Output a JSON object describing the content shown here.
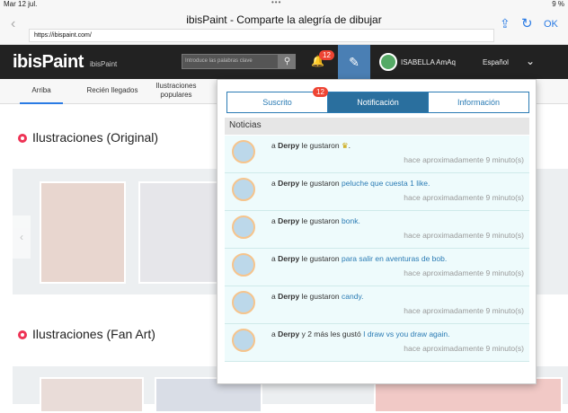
{
  "status": {
    "time": "Mar 12 jul.",
    "battery": "9 %"
  },
  "browser": {
    "title": "ibisPaint - Comparte la alegría de dibujar",
    "url": "https://ibispaint.com/",
    "done_label": "OK"
  },
  "header": {
    "logo": "ibisPaint",
    "logo_sub": "ibisPaint",
    "search_placeholder": "Introduce las palabras clave",
    "bell_count": "12",
    "username": "ISABELLA AmAq",
    "language": "Español"
  },
  "nav": {
    "tabs": [
      {
        "label": "Arriba"
      },
      {
        "label": "Recién llegados"
      },
      {
        "label": "Ilustraciones populares"
      }
    ]
  },
  "sections": [
    {
      "title": "Ilustraciones (Original)"
    },
    {
      "title": "Ilustraciones (Fan Art)"
    }
  ],
  "notifications_panel": {
    "tabs": [
      "Suscrito",
      "Notificación",
      "Información"
    ],
    "tab_badge": "12",
    "news_header": "Noticias",
    "items": [
      {
        "prefix": "a",
        "user": "Derpy",
        "verb": "le gustaron",
        "object": "",
        "time": "hace aproximadamente 9 minuto(s)"
      },
      {
        "prefix": "a",
        "user": "Derpy",
        "verb": "le gustaron",
        "object": "peluche que cuesta 1 like.",
        "time": "hace aproximadamente 9 minuto(s)"
      },
      {
        "prefix": "a",
        "user": "Derpy",
        "verb": "le gustaron",
        "object": "bonk.",
        "time": "hace aproximadamente 9 minuto(s)"
      },
      {
        "prefix": "a",
        "user": "Derpy",
        "verb": "le gustaron",
        "object": "para salir en aventuras de bob.",
        "time": "hace aproximadamente 9 minuto(s)"
      },
      {
        "prefix": "a",
        "user": "Derpy",
        "verb": "le gustaron",
        "object": "candy.",
        "time": "hace aproximadamente 9 minuto(s)"
      },
      {
        "prefix": "a",
        "user": "Derpy",
        "verb": "y 2 más les gustó",
        "object": "I draw vs you draw again.",
        "time": "hace aproximadamente 9 minuto(s)"
      }
    ]
  }
}
